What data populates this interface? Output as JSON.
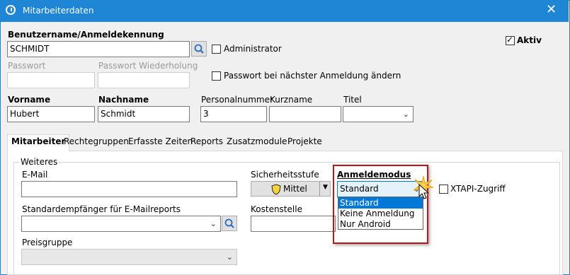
{
  "window": {
    "title": "Mitarbeiterdaten",
    "close_glyph": "✕"
  },
  "fields": {
    "username_label": "Benutzername/Anmeldekennung",
    "username_value": "SCHMIDT",
    "admin_label": "Administrator",
    "active_label": "Aktiv",
    "password_label": "Passwort",
    "password_repeat_label": "Passwort Wiederholung",
    "change_pw_label": "Passwort bei nächster Anmeldung ändern",
    "firstname_label": "Vorname",
    "firstname_value": "Hubert",
    "lastname_label": "Nachname",
    "lastname_value": "Schmidt",
    "personnel_label": "Personalnummer",
    "personnel_value": "3",
    "shortname_label": "Kurzname",
    "title_label": "Titel"
  },
  "tabs": [
    "Mitarbeiter",
    "Rechtegruppen",
    "Erfasste Zeiten",
    "Reports",
    "Zusatzmodule",
    "Projekte"
  ],
  "group": {
    "title": "Weiteres",
    "email_label": "E-Mail",
    "security_label": "Sicherheitsstufe",
    "security_value": "Mittel",
    "login_mode_label": "Anmeldemodus",
    "login_mode_value": "Standard",
    "login_mode_options": [
      "Standard",
      "Keine Anmeldung",
      "Nur Android"
    ],
    "xtapi_label": "XTAPI-Zugriff",
    "report_recipient_label": "Standardempfänger für E-Mailreports",
    "cost_center_label": "Kostenstelle",
    "price_group_label": "Preisgruppe"
  },
  "colors": {
    "titlebar": "#1e86d5",
    "highlight": "#0078d7",
    "callout": "#c0141b"
  },
  "icons": [
    "clock-icon",
    "search-icon",
    "shield-icon",
    "chevron-down-icon",
    "cursor-icon"
  ]
}
